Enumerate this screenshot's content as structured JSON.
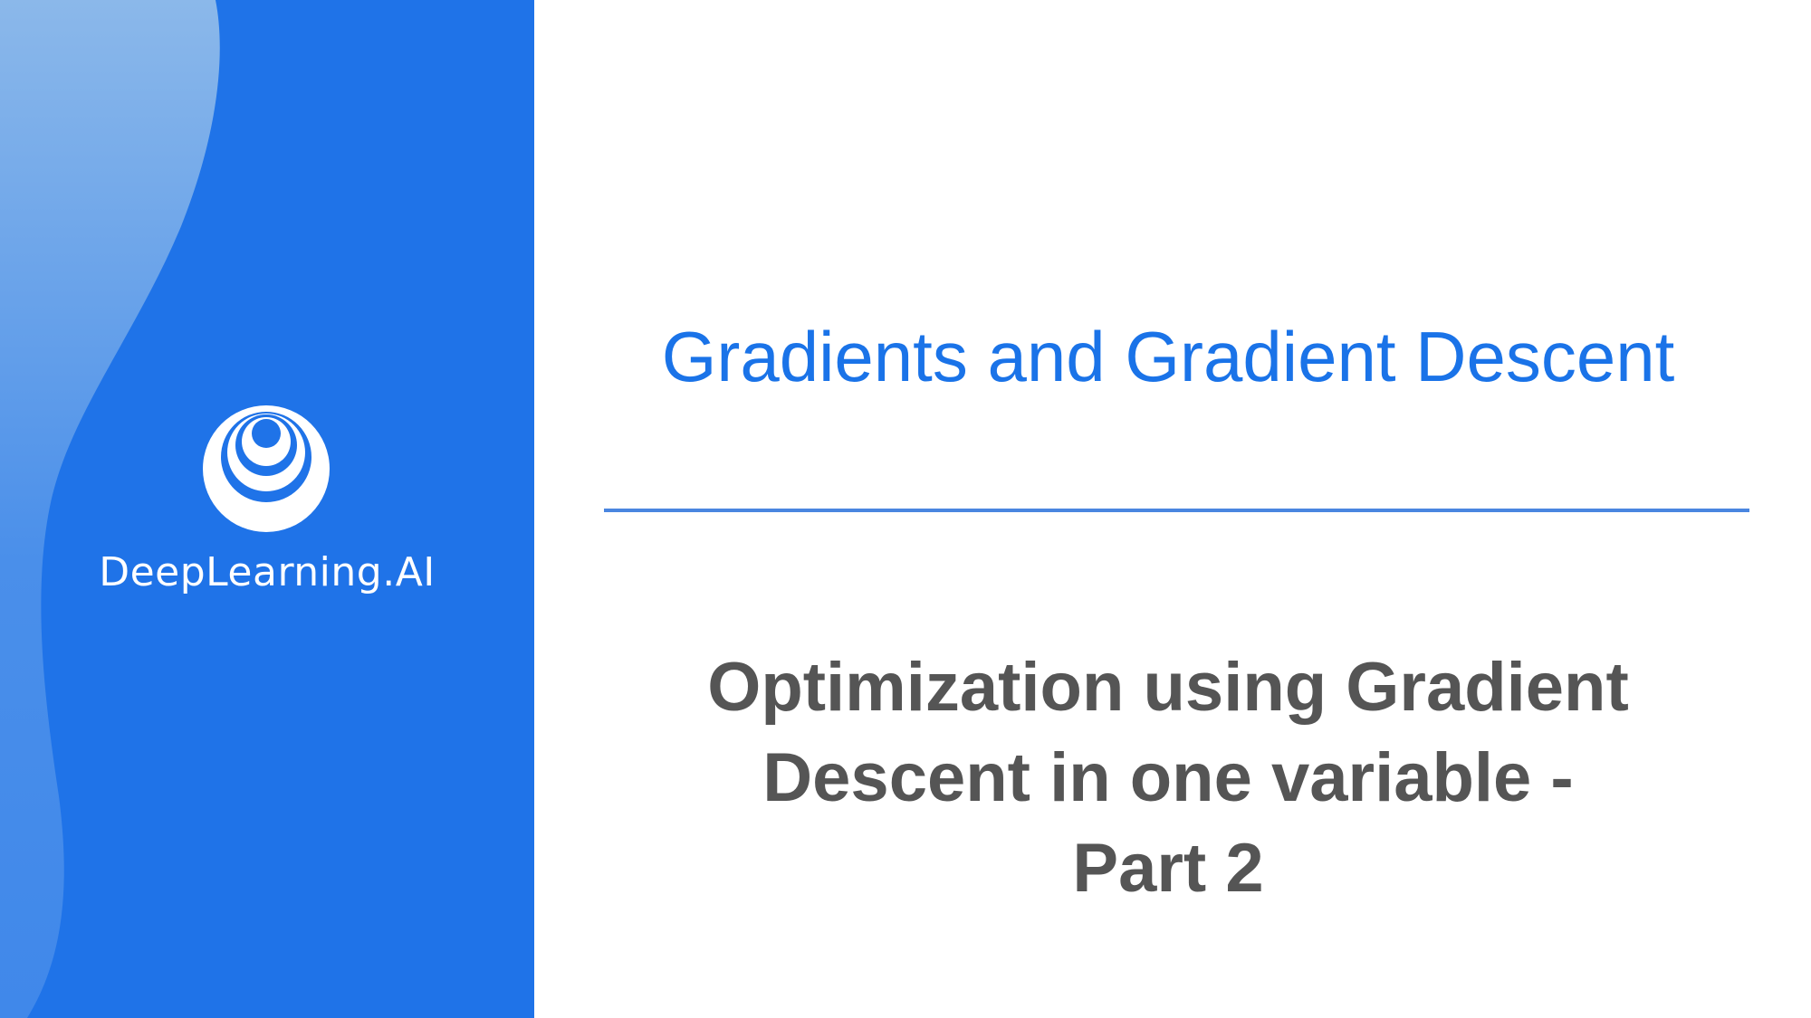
{
  "brand": {
    "name": "DeepLearning.AI",
    "logo_icon": "deeplearning-ai-logo-icon"
  },
  "slide": {
    "module_title": "Gradients and Gradient Descent",
    "lesson_title_lines": [
      "Optimization using Gradient",
      "Descent in one variable -",
      "Part 2"
    ]
  },
  "colors": {
    "panel_blue": "#1f73e8",
    "wave_light_blue": "#8bb8ea",
    "title_blue": "#1a73e8",
    "divider_blue": "#4a86e0",
    "lesson_gray": "#555555"
  }
}
